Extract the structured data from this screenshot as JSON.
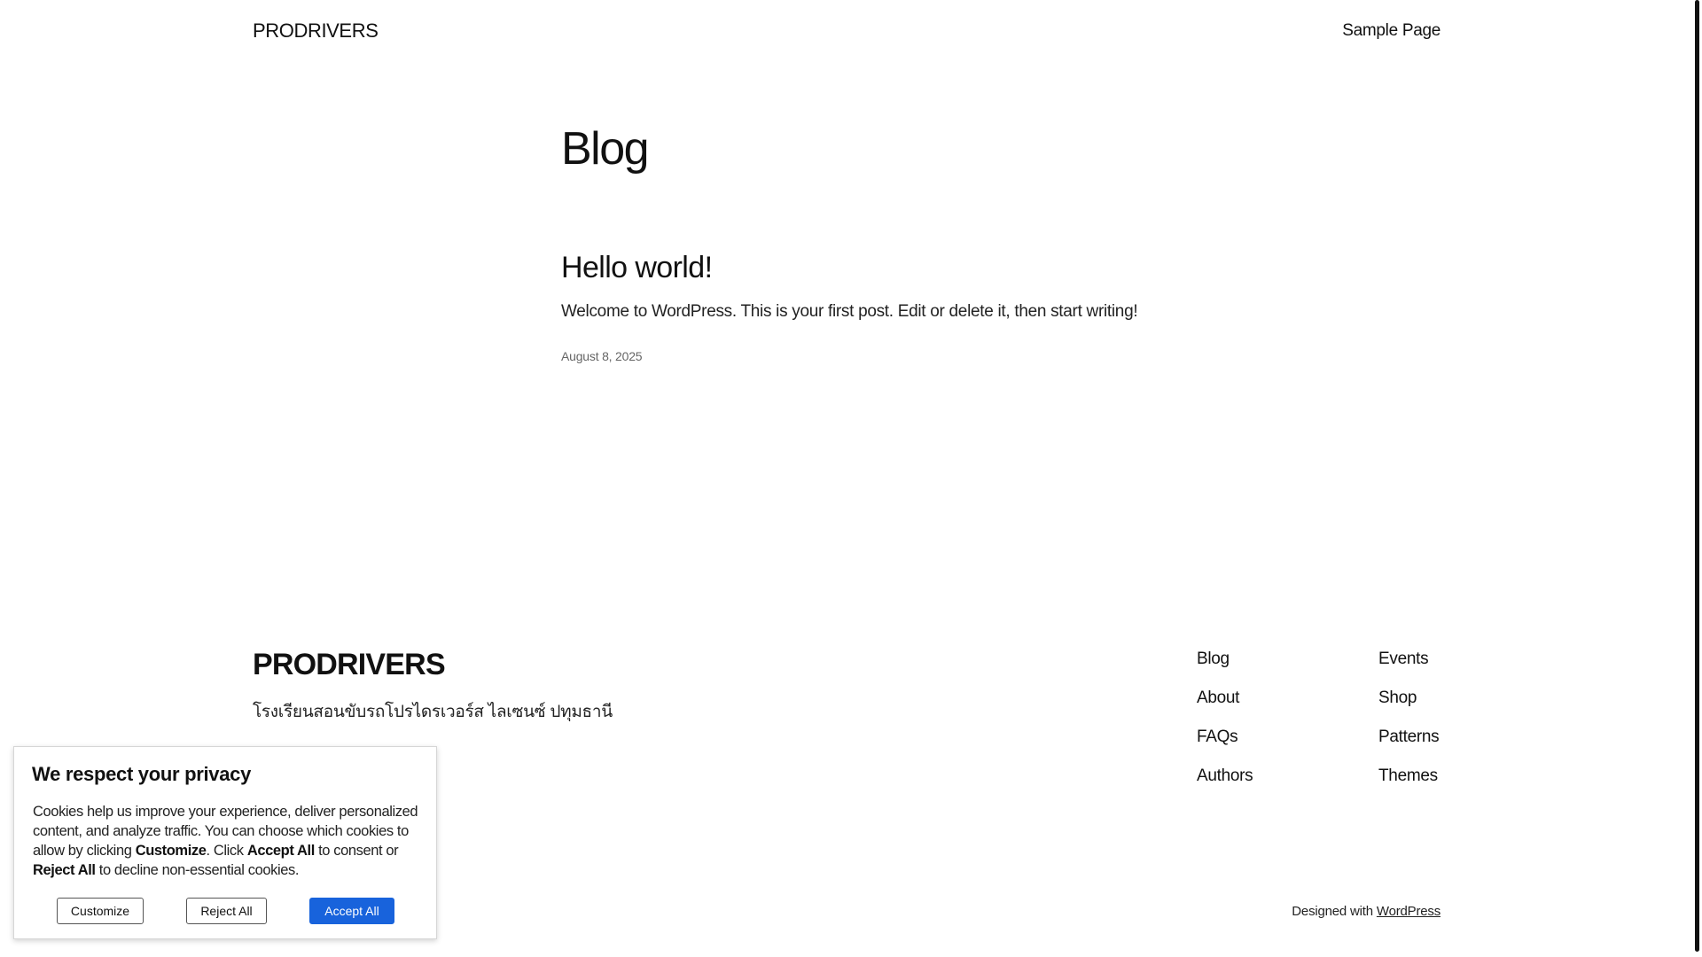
{
  "header": {
    "site_title": "PRODRIVERS",
    "nav": {
      "sample_page": "Sample Page"
    }
  },
  "main": {
    "heading": "Blog",
    "posts": [
      {
        "title": "Hello world!",
        "excerpt": "Welcome to WordPress. This is your first post. Edit or delete it, then start writing!",
        "date": "August 8, 2025"
      }
    ]
  },
  "footer": {
    "site_title": "PRODRIVERS",
    "tagline": "โรงเรียนสอนขับรถโปรไดรเวอร์ส ไลเซนซ์ ปทุมธานี",
    "links_col1": [
      "Blog",
      "About",
      "FAQs",
      "Authors"
    ],
    "links_col2": [
      "Events",
      "Shop",
      "Patterns",
      "Themes"
    ],
    "credit_prefix": "Designed with ",
    "credit_link": "WordPress"
  },
  "cookie": {
    "title": "We respect your privacy",
    "text_1": "Cookies help us improve your experience, deliver personalized content, and analyze traffic. You can choose which cookies to allow by clicking ",
    "bold_customize": "Customize",
    "text_2": ". Click ",
    "bold_accept": "Accept All",
    "text_3": " to consent or ",
    "bold_reject": "Reject All",
    "text_4": " to decline non-essential cookies.",
    "customize_label": "Customize",
    "reject_label": "Reject All",
    "accept_label": "Accept All",
    "accept_color": "#1863dc"
  }
}
